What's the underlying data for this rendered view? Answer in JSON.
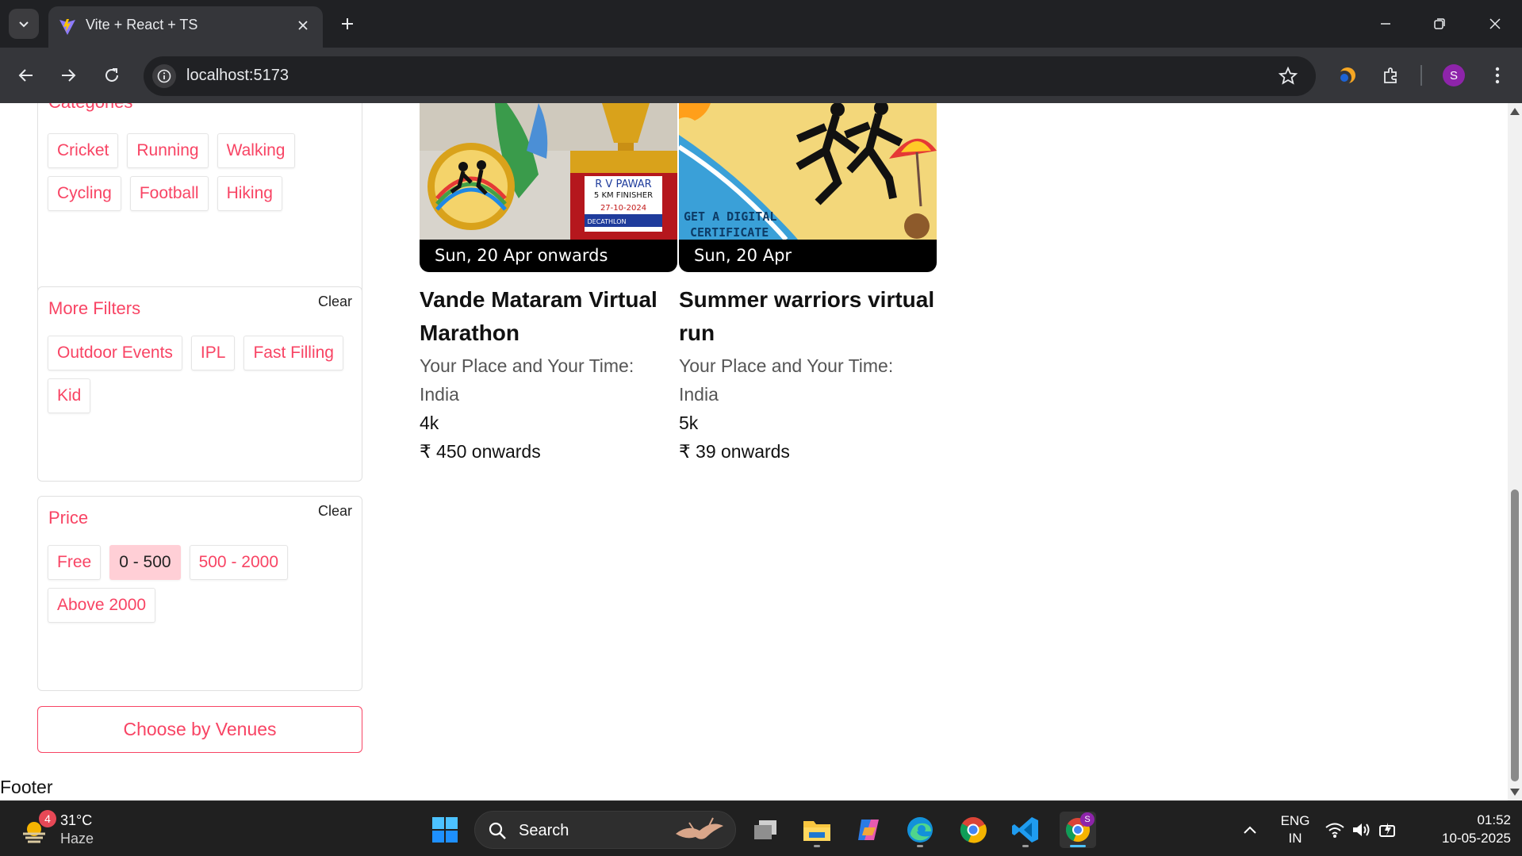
{
  "browser": {
    "tab_title": "Vite + React + TS",
    "url": "localhost:5173",
    "profile_initial": "S"
  },
  "filters": {
    "categories": {
      "title": "Categories",
      "chips": [
        "Cricket",
        "Running",
        "Walking",
        "Cycling",
        "Football",
        "Hiking"
      ]
    },
    "more_filters": {
      "title": "More Filters",
      "clear_label": "Clear",
      "chips": [
        "Outdoor Events",
        "IPL",
        "Fast Filling",
        "Kid"
      ]
    },
    "price": {
      "title": "Price",
      "clear_label": "Clear",
      "chips": [
        "Free",
        "0 - 500",
        "500 - 2000",
        "Above 2000"
      ],
      "selected": "0 - 500"
    },
    "venues_button": "Choose by Venues"
  },
  "events": [
    {
      "date": "Sun, 20 Apr onwards",
      "title": "Vande Mataram Virtual Marathon",
      "venue": "Your Place and Your Time: India",
      "category": "4k",
      "price": "₹ 450 onwards",
      "poster_text": [
        "R V PAWAR",
        "5 KM FINISHER",
        "27-10-2024",
        "DECATHLON"
      ]
    },
    {
      "date": "Sun, 20 Apr",
      "title": "Summer warriors virtual run",
      "venue": "Your Place and Your Time: India",
      "category": "5k",
      "price": "₹ 39 onwards",
      "poster_text": [
        "GET A DIGITAL",
        "CERTIFICATE"
      ]
    }
  ],
  "footer": "Footer",
  "taskbar": {
    "weather_badge": "4",
    "temperature": "31°C",
    "weather": "Haze",
    "search_label": "Search",
    "lang_top": "ENG",
    "lang_bottom": "IN",
    "time": "01:52",
    "date": "10-05-2025",
    "chrome_badge": "S"
  },
  "colors": {
    "accent": "#f84464",
    "selected_chip": "#ffcfd6",
    "chrome_dark": "#202124",
    "chrome_toolbar": "#35363a",
    "taskbar": "#202020"
  }
}
